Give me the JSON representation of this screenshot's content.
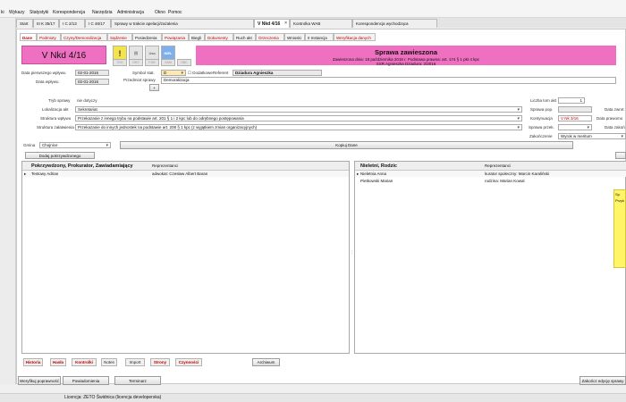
{
  "menu": [
    "Wykazy",
    "Statystyki",
    "Korespondencja",
    "Narzędzia",
    "Administracja",
    "Okno",
    "Pomoc"
  ],
  "menu_prefix": "ki",
  "doc_tabs": [
    "Start",
    "III K 35/17",
    "I C 2/13",
    "I C 46/17",
    "Sprawy w trakcie apelacji/zażalenia",
    "V Nkd 4/16",
    "Kontrolka WAB",
    "Korespondencja wychodząca"
  ],
  "sub_tabs": [
    "Dane",
    "Podmioty",
    "Czyny/Demoralizacja",
    "Sądzenie",
    "Posiedzenia",
    "Powiązania",
    "Biegli",
    "Dokumenty",
    "Ruch akt",
    "Orzeczenia",
    "Wnioski",
    "II Instancja",
    "Weryfikacja danych"
  ],
  "case_number": "V Nkd 4/16",
  "toolbar_icons": [
    {
      "name": "warning-icon",
      "text": "!"
    },
    {
      "name": "link-icon",
      "text": "⛓"
    },
    {
      "name": "usa-icon",
      "text": "Usa"
    },
    {
      "name": "niel-icon",
      "text": "NIEL"
    },
    {
      "name": "tog-icon",
      "text": "TOG"
    },
    {
      "name": "drz-icon",
      "text": "DRZ"
    },
    {
      "name": "pub-icon",
      "text": "PUB"
    },
    {
      "name": "sam-icon",
      "text": "SAM"
    },
    {
      "name": "obc-icon",
      "text": "OBC"
    }
  ],
  "banner": {
    "title": "Sprawa zawieszona",
    "line1": "Zawieszona dnia: 18 października 2016 r. Podstawa prawna: art. 174 § 1 pkt 4 kpc",
    "line2": "SSR Agnieszka Dziadura: 2/2016"
  },
  "fields": {
    "data_pierwszego_label": "Data pierwszego wpływu",
    "data_pierwszego": "02-01-2016",
    "data_wplywu_label": "Data wpływu",
    "data_wplywu": "02-01-2016",
    "symbol_label": "Symbol stat.",
    "symbol": "D",
    "dodatkowe": "Dodatkowe",
    "referent_label": "Referent",
    "referent": "Dziadura Agnieszka",
    "przedmiot_label": "Przedmiot sprawy",
    "przedmiot": "Demoralizacja",
    "plus": "+",
    "tryb_label": "Tryb sprawy",
    "tryb": "nie dotyczy",
    "lokalizacja_label": "Lokalizacja akt",
    "lokalizacja": "Sekretariat",
    "struktura_wplywu_label": "Struktura wpływu",
    "struktura_wplywu": "Przekazanie z innego trybu na podstawie art. 201 § 1 i 2 kpc lub do odrębnego postępowania",
    "struktura_zal_label": "Struktura załatwienia",
    "struktura_zal": "Przekazanie do innych jednostek na podstawie art. 200 § 1 kpc (z wyjątkiem zmian organizacyjnych)",
    "liczba_tom_label": "Liczba tom akt",
    "liczba_tom": "1",
    "sprawa_pop_label": "Sprawa pop.",
    "kontynuacja_label": "Kontynuacja",
    "kontynuacja": "V Nk 3/16",
    "sprawa_przek_label": "Sprawa przek.",
    "zakonczenie_label": "Zakończenie",
    "zakonczenie": "Wyrok w meritum",
    "data_zwrotu_label": "Data zwrot",
    "data_prawom_label": "Data prawomo",
    "data_zakon_label": "Data zakoń"
  },
  "gmina_label": "Gmina",
  "gmina": "Chojnice",
  "kopiuj": "Kopiuj Dane",
  "dodaj": "Dodaj pokrzywdzonego",
  "left_grid": {
    "h1": "Pokrzywdzony, Prokurator, Zawiadamiający",
    "h2": "Reprezentanci",
    "rows": [
      {
        "name": "Testowy Adrian",
        "rep": "adwokat: Czesław Albert Baran"
      }
    ]
  },
  "right_grid": {
    "h1": "Nieletni, Rodzic",
    "h2": "Reprezentanci",
    "rows": [
      {
        "name": "Nieletnia Anna",
        "rep": "kurator społeczny: Marcin Karaliński"
      },
      {
        "name": "Pietkowski Marian",
        "rep": "rodzina: Marian Kowal"
      }
    ]
  },
  "bottom_tabs": [
    "Historia",
    "Hasła",
    "Kontrolki",
    "Notes",
    "Import",
    "Strony",
    "Czynności"
  ],
  "archiwum": "Archiwum",
  "footer_buttons": [
    "Weryfikuj poprawność",
    "Powiadomienia",
    "Terminarz"
  ],
  "footer_right": "Zakończ edycję sprawy",
  "sticky": {
    "a": "Sp.",
    "b": "Przyk"
  },
  "status": "Licencja: ZETO Świdnica (licencja developerska)",
  "colors": {
    "case_pink": "#ef6fc0",
    "red_tab": "#c00000",
    "sticky": "#fff566"
  }
}
